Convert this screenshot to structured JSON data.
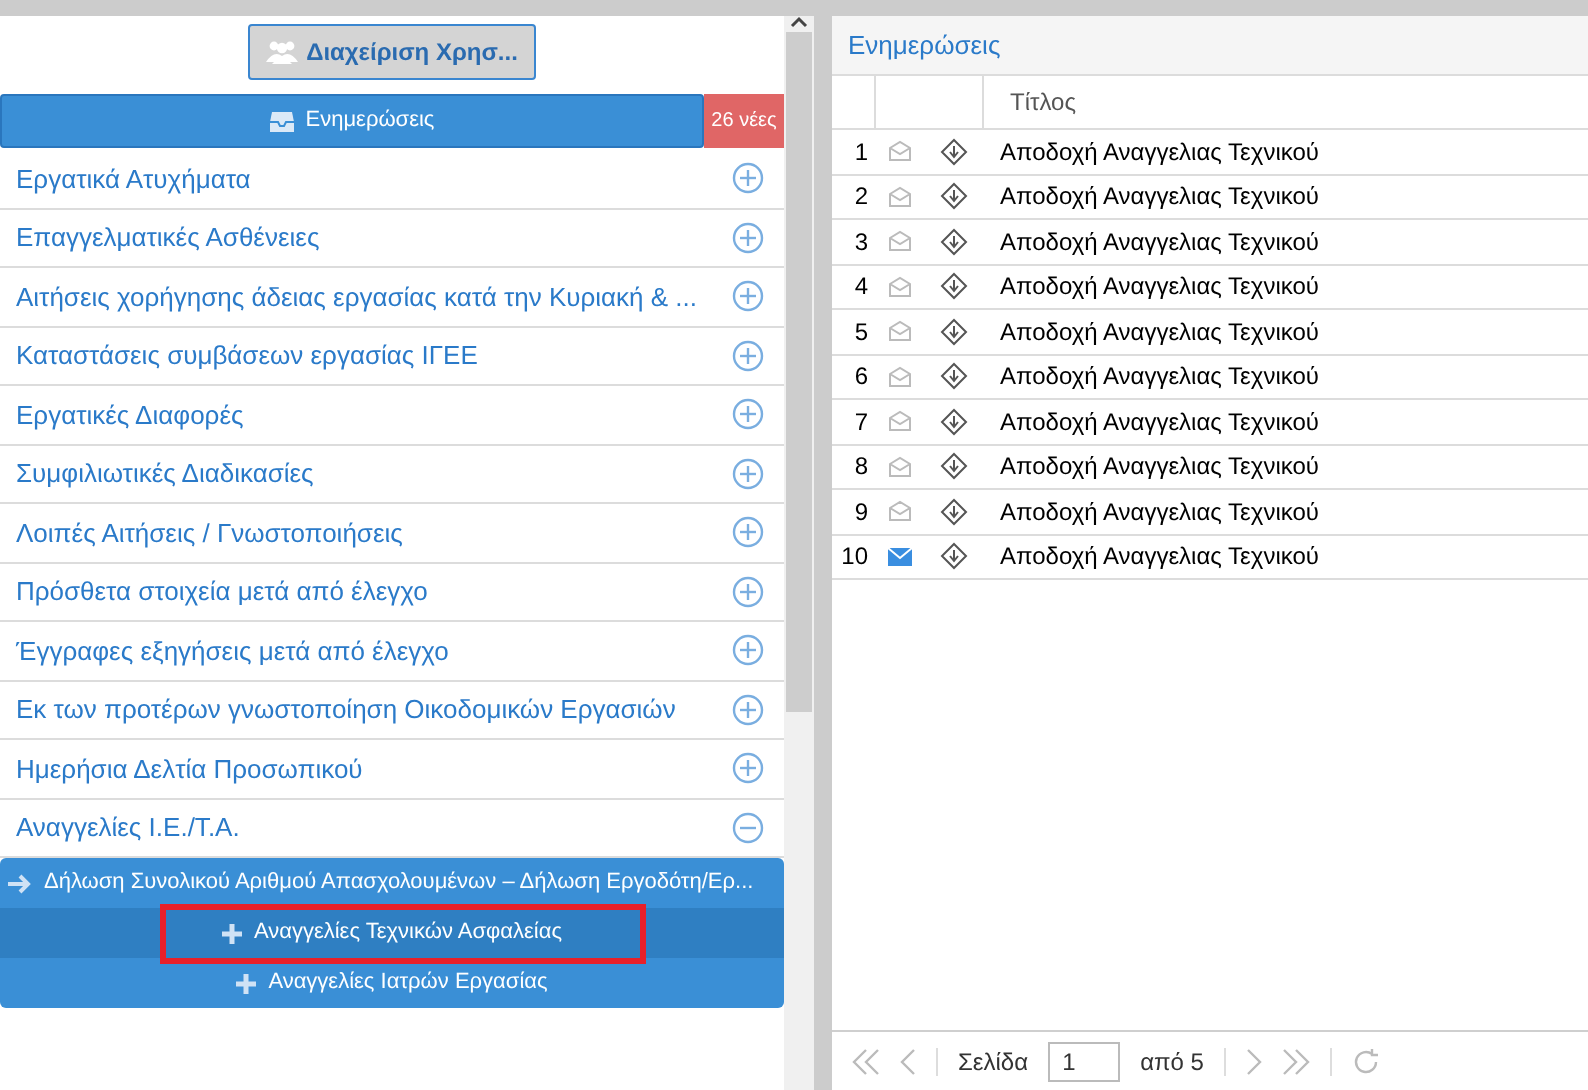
{
  "user_button": {
    "label": "Διαχείριση Χρησ..."
  },
  "updates_button": {
    "label": "Ενημερώσεις",
    "badge": "26 νέες"
  },
  "categories": [
    {
      "label": "Εργατικά Ατυχήματα",
      "expanded": false
    },
    {
      "label": "Επαγγελματικές Ασθένειες",
      "expanded": false
    },
    {
      "label": "Αιτήσεις χορήγησης άδειας εργασίας κατά την Κυριακή & ...",
      "expanded": false
    },
    {
      "label": "Καταστάσεις συμβάσεων εργασίας ΙΓΕΕ",
      "expanded": false
    },
    {
      "label": "Εργατικές Διαφορές",
      "expanded": false
    },
    {
      "label": "Συμφιλιωτικές Διαδικασίες",
      "expanded": false
    },
    {
      "label": "Λοιπές Αιτήσεις / Γνωστοποιήσεις",
      "expanded": false
    },
    {
      "label": "Πρόσθετα στοιχεία μετά από έλεγχο",
      "expanded": false
    },
    {
      "label": "Έγγραφες εξηγήσεις μετά από έλεγχο",
      "expanded": false
    },
    {
      "label": "Εκ των προτέρων γνωστοποίηση Οικοδομικών Εργασιών",
      "expanded": false
    },
    {
      "label": "Ημερήσια Δελτία Προσωπικού",
      "expanded": false
    },
    {
      "label": "Αναγγελίες Ι.Ε./Τ.Α.",
      "expanded": true,
      "children": [
        {
          "label": "Δήλωση Συνολικού Αριθμού Απασχολουμένων – Δήλωση Εργοδότη/Ερ...",
          "kind": "arrow",
          "selected": false,
          "highlighted": false
        },
        {
          "label": "Αναγγελίες Τεχνικών Ασφαλείας",
          "kind": "plus",
          "selected": true,
          "highlighted": true
        },
        {
          "label": "Αναγγελίες Ιατρών Εργασίας",
          "kind": "plus",
          "selected": false,
          "highlighted": false
        }
      ]
    }
  ],
  "updates_panel": {
    "title": "Ενημερώσεις",
    "columns": [
      "Τίτλος"
    ],
    "rows": [
      {
        "number": "1",
        "read": true,
        "title": "Αποδοχή Αναγγελιας Τεχνικού"
      },
      {
        "number": "2",
        "read": true,
        "title": "Αποδοχή Αναγγελιας Τεχνικού"
      },
      {
        "number": "3",
        "read": true,
        "title": "Αποδοχή Αναγγελιας Τεχνικού"
      },
      {
        "number": "4",
        "read": true,
        "title": "Αποδοχή Αναγγελιας Τεχνικού"
      },
      {
        "number": "5",
        "read": true,
        "title": "Αποδοχή Αναγγελιας Τεχνικού"
      },
      {
        "number": "6",
        "read": true,
        "title": "Αποδοχή Αναγγελιας Τεχνικού"
      },
      {
        "number": "7",
        "read": true,
        "title": "Αποδοχή Αναγγελιας Τεχνικού"
      },
      {
        "number": "8",
        "read": true,
        "title": "Αποδοχή Αναγγελιας Τεχνικού"
      },
      {
        "number": "9",
        "read": true,
        "title": "Αποδοχή Αναγγελιας Τεχνικού"
      },
      {
        "number": "10",
        "read": false,
        "title": "Αποδοχή Αναγγελιας Τεχνικού"
      }
    ],
    "pager": {
      "page_label": "Σελίδα",
      "page": "1",
      "of_label": "από 5"
    }
  }
}
